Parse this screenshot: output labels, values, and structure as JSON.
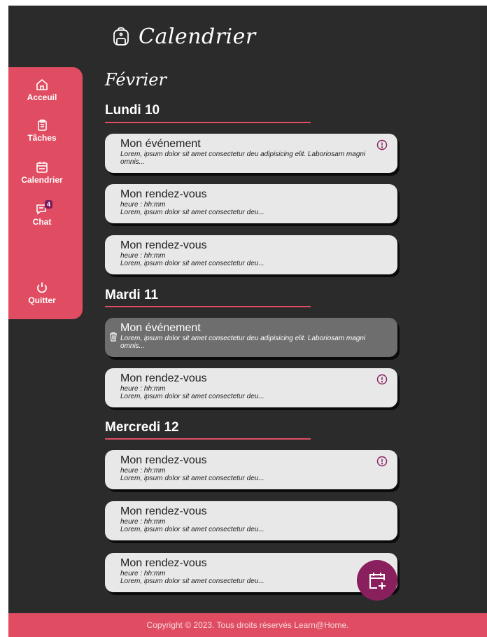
{
  "header": {
    "title": "Calendrier",
    "icon": "backpack-icon"
  },
  "sidebar": {
    "items": [
      {
        "label": "Acceuil",
        "icon": "home-icon"
      },
      {
        "label": "Tâches",
        "icon": "clipboard-icon"
      },
      {
        "label": "Calendrier",
        "icon": "calendar-icon"
      },
      {
        "label": "Chat",
        "icon": "chat-icon",
        "badge": "4"
      },
      {
        "label": "Quitter",
        "icon": "power-icon"
      }
    ]
  },
  "main": {
    "month": "Février",
    "days": [
      {
        "heading": "Lundi 10",
        "events": [
          {
            "title": "Mon événement",
            "desc": "Lorem, ipsum dolor sit amet consectetur deu adipisicing elit. Laboriosam magni omnis...",
            "alert": true
          },
          {
            "title": "Mon rendez-vous",
            "time": "heure : hh:mm",
            "desc": "Lorem, ipsum dolor sit amet consectetur deu..."
          },
          {
            "title": "Mon rendez-vous",
            "time": "heure : hh:mm",
            "desc": "Lorem, ipsum dolor sit amet consectetur deu..."
          }
        ]
      },
      {
        "heading": "Mardi 11",
        "events": [
          {
            "title": "Mon événement",
            "desc": "Lorem, ipsum dolor sit amet consectetur deu adipisicing elit. Laboriosam magni omnis...",
            "selected": true
          },
          {
            "title": "Mon rendez-vous",
            "time": "heure : hh:mm",
            "desc": "Lorem, ipsum dolor sit amet consectetur deu...",
            "alert": true
          }
        ]
      },
      {
        "heading": "Mercredi 12",
        "events": [
          {
            "title": "Mon rendez-vous",
            "time": "heure : hh:mm",
            "desc": "Lorem, ipsum dolor sit amet consectetur deu...",
            "alert": true
          },
          {
            "title": "Mon rendez-vous",
            "time": "heure : hh:mm",
            "desc": "Lorem, ipsum dolor sit amet consectetur deu..."
          },
          {
            "title": "Mon rendez-vous",
            "time": "heure : hh:mm",
            "desc": "Lorem, ipsum dolor sit amet consectetur deu..."
          }
        ]
      }
    ]
  },
  "fab": {
    "icon": "add-event-icon"
  },
  "footer": {
    "text": "Copyright © 2023. Tous droits réservés Learn@Home."
  },
  "colors": {
    "background": "#2b2b2b",
    "accent": "#e04d62",
    "fab": "#8a1f5e",
    "card": "#e8e8e8",
    "card_selected": "#6e6e6e"
  }
}
